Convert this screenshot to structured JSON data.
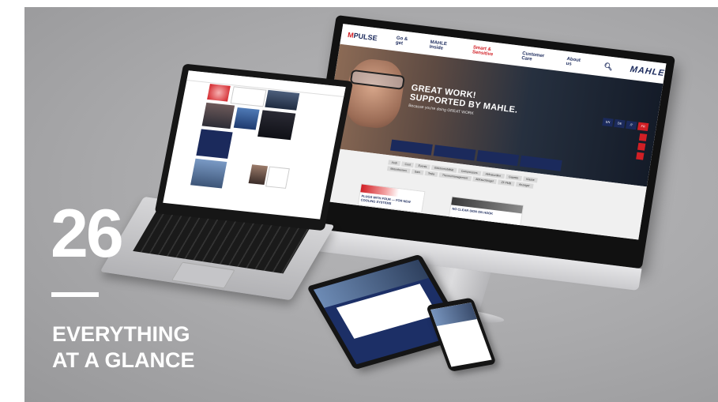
{
  "issue_number": "26",
  "headline": [
    "EVERYTHING",
    "AT A GLANCE"
  ],
  "website": {
    "logo": "PULSE",
    "logo_mark": "M",
    "nav": [
      "Go & get",
      "MAHLE Inside",
      "Smart & Sensitive",
      "Customer Care",
      "About us"
    ],
    "active_nav": "Smart & Sensitive",
    "brand": "MAHLE",
    "search_icon": "search-icon",
    "hero_title": [
      "GREAT WORK!",
      "SUPPORTED BY MAHLE."
    ],
    "hero_subtitle": "Because you're doing GREAT WORK",
    "languages": [
      "EN",
      "DE",
      "IT",
      "FR"
    ],
    "active_language": "FR",
    "tags": [
      "Audi",
      "Cool",
      "Events",
      "Elektromobilität",
      "Compressors",
      "Abfrasurdien",
      "Gazette",
      "Klasse",
      "Motorthemen",
      "Sam",
      "Tesla",
      "Thermomanagement",
      "Abfrauchbügel",
      "ZF FMB",
      "Anzeiger"
    ],
    "cards": [
      "PLUGS WITH FOUR — FOR NEW COOLING SYSTEMS",
      "NO CLEAR SIGN ON HOOK"
    ]
  },
  "colors": {
    "brand_blue": "#1b2a5c",
    "brand_red": "#d11f25",
    "overlay_text": "#ffffff",
    "background": "#a9a9ab"
  }
}
